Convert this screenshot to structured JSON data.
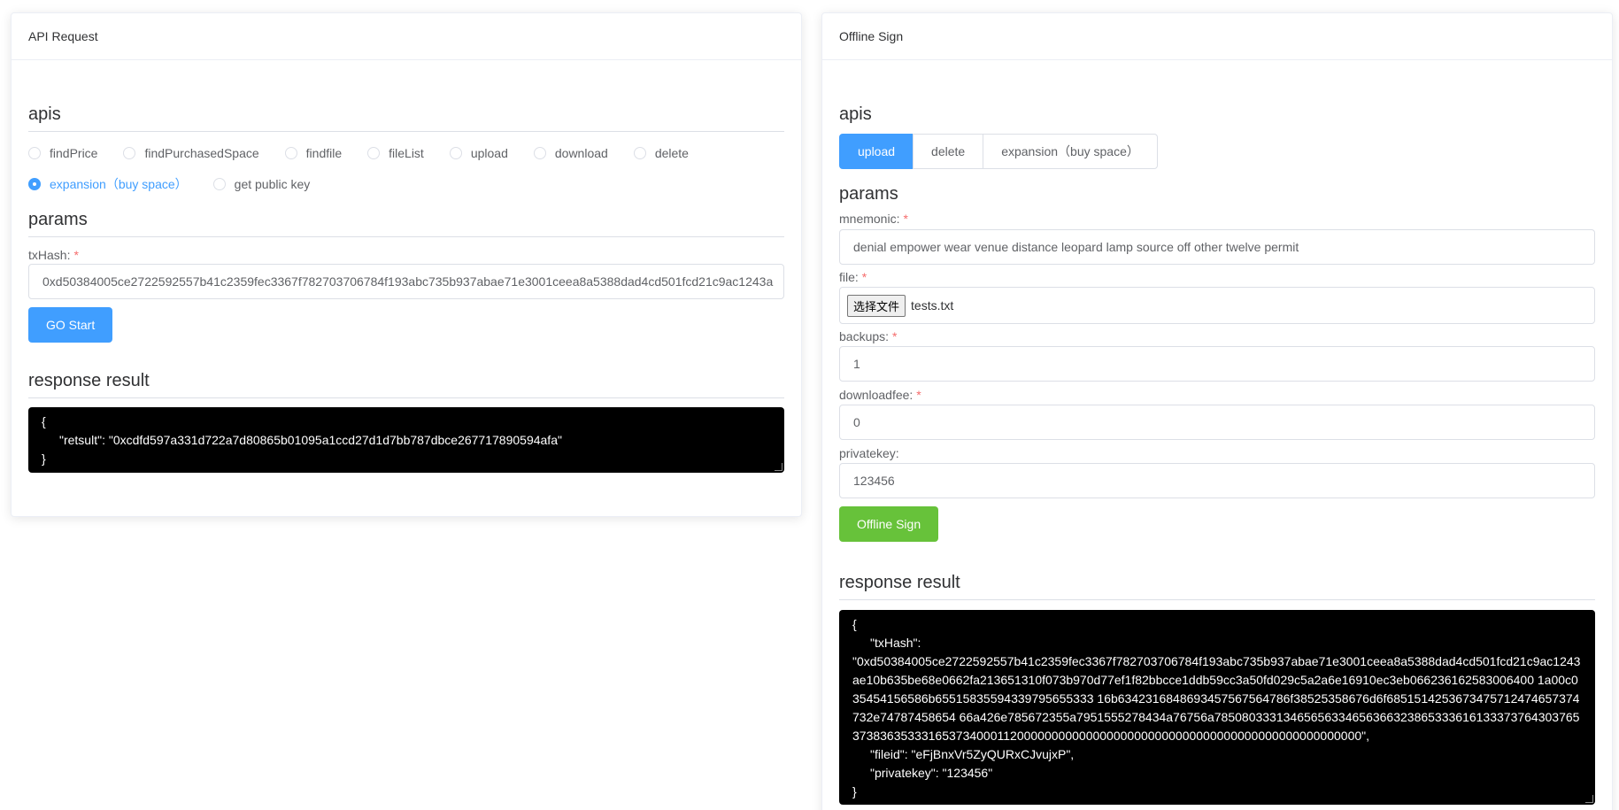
{
  "left": {
    "header": "API Request",
    "apis_title": "apis",
    "radios": [
      {
        "label": "findPrice",
        "checked": false
      },
      {
        "label": "findPurchasedSpace",
        "checked": false
      },
      {
        "label": "findfile",
        "checked": false
      },
      {
        "label": "fileList",
        "checked": false
      },
      {
        "label": "upload",
        "checked": false
      },
      {
        "label": "download",
        "checked": false
      },
      {
        "label": "delete",
        "checked": false
      },
      {
        "label": "expansion（buy space）",
        "checked": true
      },
      {
        "label": "get public key",
        "checked": false
      }
    ],
    "params_title": "params",
    "txhash_label": "txHash:",
    "txhash_required": "*",
    "txhash_value": "0xd50384005ce2722592557b41c2359fec3367f782703706784f193abc735b937abae71e3001ceea8a5388dad4cd501fcd21c9ac1243a",
    "go_button": "GO Start",
    "response_title": "response result",
    "result": {
      "open": "{",
      "line": "\"retsult\": \"0xcdfd597a331d722a7d80865b01095a1ccd27d1d7bb787dbce267717890594afa\"",
      "close": "}"
    }
  },
  "right": {
    "header": "Offline Sign",
    "apis_title": "apis",
    "tabs": [
      {
        "label": "upload",
        "active": true
      },
      {
        "label": "delete",
        "active": false
      },
      {
        "label": "expansion（buy space）",
        "active": false
      }
    ],
    "params_title": "params",
    "mnemonic_label": "mnemonic:",
    "mnemonic_value": "denial empower wear venue distance leopard lamp source off other twelve permit",
    "file_label": "file:",
    "file_button": "选择文件",
    "file_name": "tests.txt",
    "backups_label": "backups:",
    "backups_value": "1",
    "downloadfee_label": "downloadfee:",
    "downloadfee_value": "0",
    "privatekey_label": "privatekey:",
    "privatekey_value": "123456",
    "required": "*",
    "sign_button": "Offline Sign",
    "response_title": "response result",
    "result": {
      "open": "{",
      "txhash_key": "\"txHash\":",
      "txhash_value": "\"0xd50384005ce2722592557b41c2359fec3367f782703706784f193abc735b937abae71e3001ceea8a5388dad4cd501fcd21c9ac1243ae10b635be68e0662fa213651310f073b970d77ef1f82bbcce1ddb59cc3a50fd029c5a2a6e16910ec3eb066236162583006400 1a00c035454156586b65515835594339795655333 16b6342316848693457567564786f38525358676d6f6851514253673475712474657374732e74787458654 66a426e785672355a7951555278434a76756a7850803331346565633465636632386533361613337376430376537383635333165373400011200000000000000000000000000000000000000000000000000\",",
      "fileid_line": "\"fileid\": \"eFjBnxVr5ZyQURxCJvujxP\",",
      "privatekey_line": "\"privatekey\": \"123456\"",
      "close": "}"
    }
  }
}
